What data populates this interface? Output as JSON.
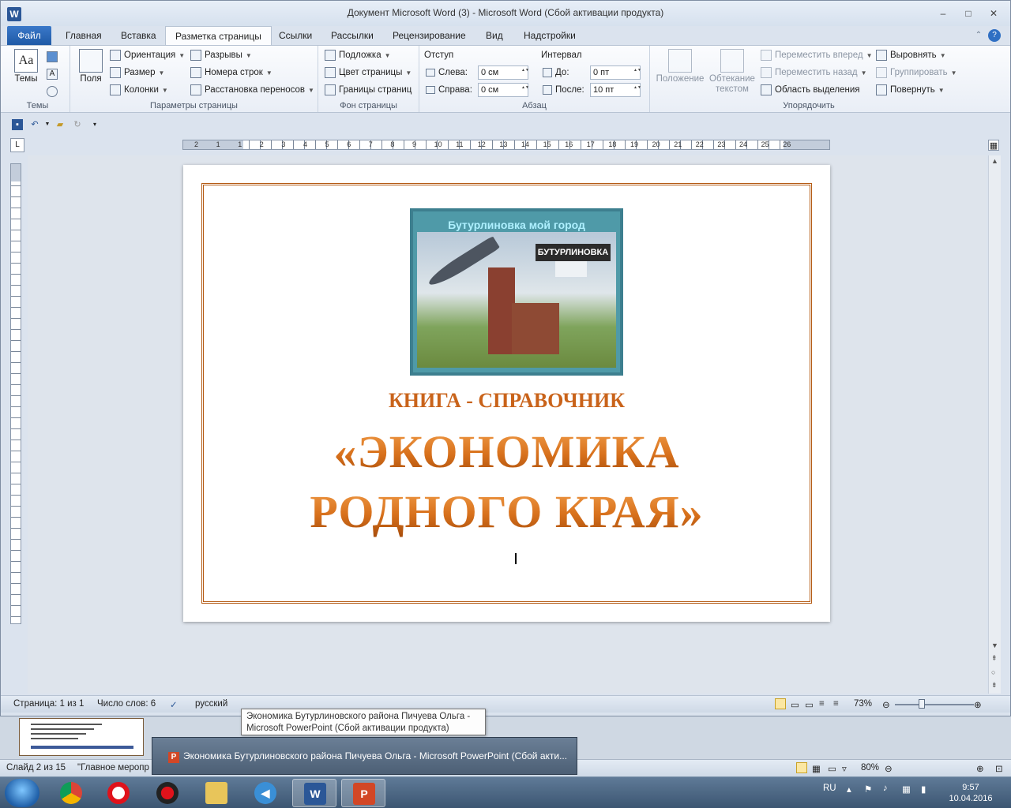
{
  "window": {
    "title": "Документ Microsoft Word (3)  -  Microsoft Word (Сбой активации продукта)",
    "app_icon": "W",
    "controls": [
      "–",
      "□",
      "✕"
    ]
  },
  "tabs": [
    {
      "label": "Файл"
    },
    {
      "label": "Главная"
    },
    {
      "label": "Вставка"
    },
    {
      "label": "Разметка страницы"
    },
    {
      "label": "Ссылки"
    },
    {
      "label": "Рассылки"
    },
    {
      "label": "Рецензирование"
    },
    {
      "label": "Вид"
    },
    {
      "label": "Надстройки"
    }
  ],
  "ribbon": {
    "themes": {
      "label": "Темы",
      "button": "Темы"
    },
    "page_setup": {
      "label": "Параметры страницы",
      "fields": "Поля",
      "orientation": "Ориентация",
      "size": "Размер",
      "columns": "Колонки",
      "breaks": "Разрывы",
      "line_numbers": "Номера строк",
      "hyphenation": "Расстановка переносов"
    },
    "page_background": {
      "label": "Фон страницы",
      "watermark": "Подложка",
      "page_color": "Цвет страницы",
      "page_borders": "Границы страниц"
    },
    "paragraph": {
      "label": "Абзац",
      "indent": "Отступ",
      "left": "Слева:",
      "left_value": "0 см",
      "right": "Справа:",
      "right_value": "0 см",
      "spacing": "Интервал",
      "before": "До:",
      "before_value": "0 пт",
      "after": "После:",
      "after_value": "10 пт"
    },
    "arrange": {
      "label": "Упорядочить",
      "position": "Положение",
      "wrap": "Обтекание текстом",
      "bring_forward": "Переместить вперед",
      "send_backward": "Переместить назад",
      "selection_pane": "Область выделения",
      "align": "Выровнять",
      "group": "Группировать",
      "rotate": "Повернуть"
    }
  },
  "ruler_numbers": [
    "2",
    "1",
    "1",
    "2",
    "3",
    "4",
    "5",
    "6",
    "7",
    "8",
    "9",
    "10",
    "11",
    "12",
    "13",
    "14",
    "15",
    "16",
    "17",
    "18",
    "19",
    "20",
    "21",
    "22",
    "23",
    "24",
    "25",
    "26"
  ],
  "document": {
    "image_title": "Бутурлиновка мой город",
    "image_sign": "БУТУРЛИНОВКА",
    "subtitle": "КНИГА - СПРАВОЧНИК",
    "title_line1": "«ЭКОНОМИКА",
    "title_line2": "РОДНОГО КРАЯ»"
  },
  "status": {
    "page": "Страница: 1 из 1",
    "words": "Число слов: 6",
    "language": "русский",
    "zoom": "73%"
  },
  "powerpoint": {
    "slide": "Слайд 2 из 15",
    "theme": "\"Главное меропр",
    "zoom": "80%",
    "tooltip_line1": "Экономика Бутурлиновского района Пичуева Ольга -",
    "tooltip_line2": "Microsoft PowerPoint (Сбой активации продукта)",
    "preview_label": "Экономика Бутурлиновского района Пичуева Ольга - Microsoft PowerPoint (Сбой акти..."
  },
  "taskbar": {
    "language": "RU",
    "time": "9:57",
    "date": "10.04.2016"
  },
  "colors": {
    "accent": "#2b5797",
    "title_orange": "#d06d16",
    "border_brown": "#b45b14"
  }
}
